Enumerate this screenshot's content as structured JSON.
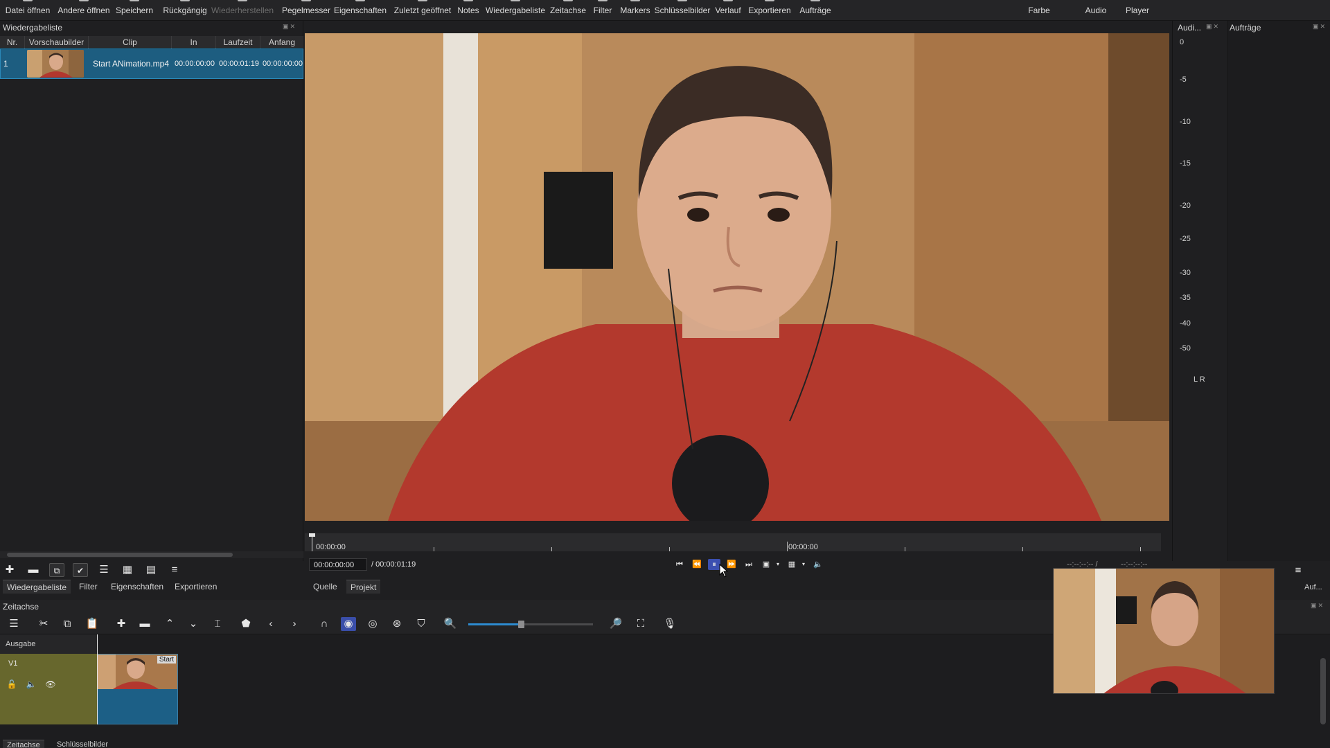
{
  "toolbar": {
    "items": [
      {
        "label": "Datei öffnen",
        "disabled": false
      },
      {
        "label": "Andere öffnen",
        "disabled": false
      },
      {
        "label": "Speichern",
        "disabled": false
      },
      {
        "label": "Rückgängig",
        "disabled": false
      },
      {
        "label": "Wiederherstellen",
        "disabled": true
      },
      {
        "label": "Pegelmesser",
        "disabled": false
      },
      {
        "label": "Eigenschaften",
        "disabled": false
      },
      {
        "label": "Zuletzt geöffnet",
        "disabled": false
      },
      {
        "label": "Notes",
        "disabled": false
      },
      {
        "label": "Wiedergabeliste",
        "disabled": false
      },
      {
        "label": "Zeitachse",
        "disabled": false
      },
      {
        "label": "Filter",
        "disabled": false
      },
      {
        "label": "Markers",
        "disabled": false
      },
      {
        "label": "Schlüsselbilder",
        "disabled": false
      },
      {
        "label": "Verlauf",
        "disabled": false
      },
      {
        "label": "Exportieren",
        "disabled": false
      },
      {
        "label": "Aufträge",
        "disabled": false
      }
    ],
    "layouts": [
      "Farbe",
      "Audio",
      "Player"
    ]
  },
  "playlist": {
    "title": "Wiedergabeliste",
    "columns": [
      "Nr.",
      "Vorschaubilder",
      "Clip",
      "In",
      "Laufzeit",
      "Anfang"
    ],
    "rows": [
      {
        "nr": "1",
        "clip": "Start ANimation.mp4",
        "in": "00:00:00:00",
        "duration": "00:00:01:19",
        "start": "00:00:00:00"
      }
    ],
    "tools": [
      "plus-icon",
      "minus-icon",
      "update-icon",
      "check-icon",
      "list-view-icon",
      "grid-view-icon",
      "detail-view-icon",
      "menu-icon"
    ],
    "tabs": [
      "Wiedergabeliste",
      "Filter",
      "Eigenschaften",
      "Exportieren"
    ]
  },
  "player": {
    "ruler_start": "00:00:00",
    "ruler_mid": "00:00:00",
    "current_time": "00:00:00:00",
    "total_time": "/ 00:00:01:19",
    "tabs": [
      "Quelle",
      "Projekt"
    ],
    "in_out_left": "--:--:--:-- /",
    "in_out_right": "--:--:--:--"
  },
  "audio_meter": {
    "title": "Audi...",
    "levels": [
      "0",
      "-5",
      "-10",
      "-15",
      "-20",
      "-25",
      "-30",
      "-35",
      "-40",
      "-50"
    ],
    "channels": "L  R"
  },
  "jobs": {
    "title": "Aufträge",
    "tab": "Auf..."
  },
  "timeline": {
    "title": "Zeitachse",
    "output_label": "Ausgabe",
    "track_name": "V1",
    "clip_label": "Start",
    "zoom_level": 0.42,
    "bottom_tabs": [
      "Zeitachse",
      "Schlüsselbilder"
    ]
  },
  "colors": {
    "accent": "#2d8bd0",
    "selection": "#1d5d80",
    "track_header": "#67672d",
    "active_toggle": "#3a4ea9"
  }
}
